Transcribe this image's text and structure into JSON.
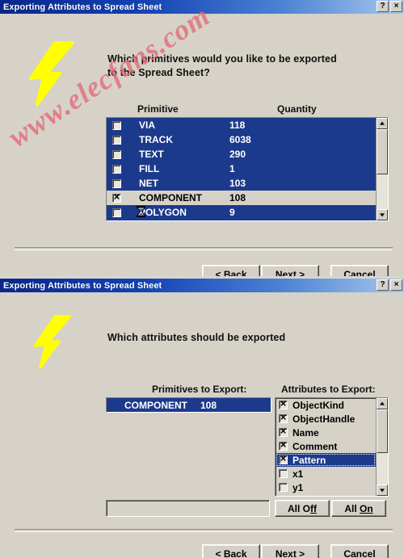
{
  "window1": {
    "title": "Exporting Attributes to Spread Sheet",
    "help_button": "?",
    "close_button": "×",
    "prompt_line1": "Which primitives would you like to be exported",
    "prompt_line2": "to the Spread Sheet?",
    "columns": {
      "primitive": "Primitive",
      "quantity": "Quantity"
    },
    "rows": [
      {
        "name": "VIA",
        "quantity": "118",
        "checked": false,
        "highlighted": true,
        "cursor": false
      },
      {
        "name": "TRACK",
        "quantity": "6038",
        "checked": false,
        "highlighted": true,
        "cursor": false
      },
      {
        "name": "TEXT",
        "quantity": "290",
        "checked": false,
        "highlighted": true,
        "cursor": false
      },
      {
        "name": "FILL",
        "quantity": "1",
        "checked": false,
        "highlighted": true,
        "cursor": false
      },
      {
        "name": "NET",
        "quantity": "103",
        "checked": false,
        "highlighted": true,
        "cursor": false
      },
      {
        "name": "COMPONENT",
        "quantity": "108",
        "checked": true,
        "highlighted": false,
        "cursor": false
      },
      {
        "name": "POLYGON",
        "quantity": "9",
        "checked": false,
        "highlighted": true,
        "cursor": true
      }
    ],
    "buttons": {
      "back": {
        "prefix": "< ",
        "accel": "B",
        "suffix": "ack"
      },
      "next": {
        "prefix": "",
        "accel": "N",
        "suffix": "ext >"
      },
      "cancel": {
        "prefix": "",
        "accel": "C",
        "suffix": "ancel"
      }
    }
  },
  "window2": {
    "title": "Exporting Attributes to Spread Sheet",
    "help_button": "?",
    "close_button": "×",
    "prompt_line1": "Which attributes should be exported",
    "primitives_label": "Primitives to Export:",
    "attributes_label": "Attributes to Export:",
    "primitives_items": [
      {
        "name": "COMPONENT",
        "quantity": "108",
        "selected": true
      }
    ],
    "attributes": [
      {
        "label": "ObjectKind",
        "checked": true,
        "selected": false
      },
      {
        "label": "ObjectHandle",
        "checked": true,
        "selected": false
      },
      {
        "label": "Name",
        "checked": true,
        "selected": false
      },
      {
        "label": "Comment",
        "checked": true,
        "selected": false
      },
      {
        "label": "Pattern",
        "checked": true,
        "selected": true
      },
      {
        "label": "x1",
        "checked": false,
        "selected": false
      },
      {
        "label": "y1",
        "checked": false,
        "selected": false
      }
    ],
    "all_off_button": {
      "prefix": "All O",
      "accel": "ff",
      "suffix": ""
    },
    "all_on_button": {
      "prefix": "All ",
      "accel": "On",
      "suffix": ""
    },
    "buttons": {
      "back": {
        "prefix": "< ",
        "accel": "B",
        "suffix": "ack"
      },
      "next": {
        "prefix": "",
        "accel": "N",
        "suffix": "ext >"
      },
      "cancel": {
        "prefix": "",
        "accel": "C",
        "suffix": "ancel"
      }
    }
  },
  "watermark": {
    "text": "www.elecfans.com",
    "color": "#e26c78"
  },
  "theme": {
    "titlebar_start": "#08268c",
    "titlebar_end": "#a8c8ec",
    "dialog_face": "#d6d2c8",
    "selection_blue": "#1c3a8c",
    "bolt_yellow": "#ffff00"
  }
}
